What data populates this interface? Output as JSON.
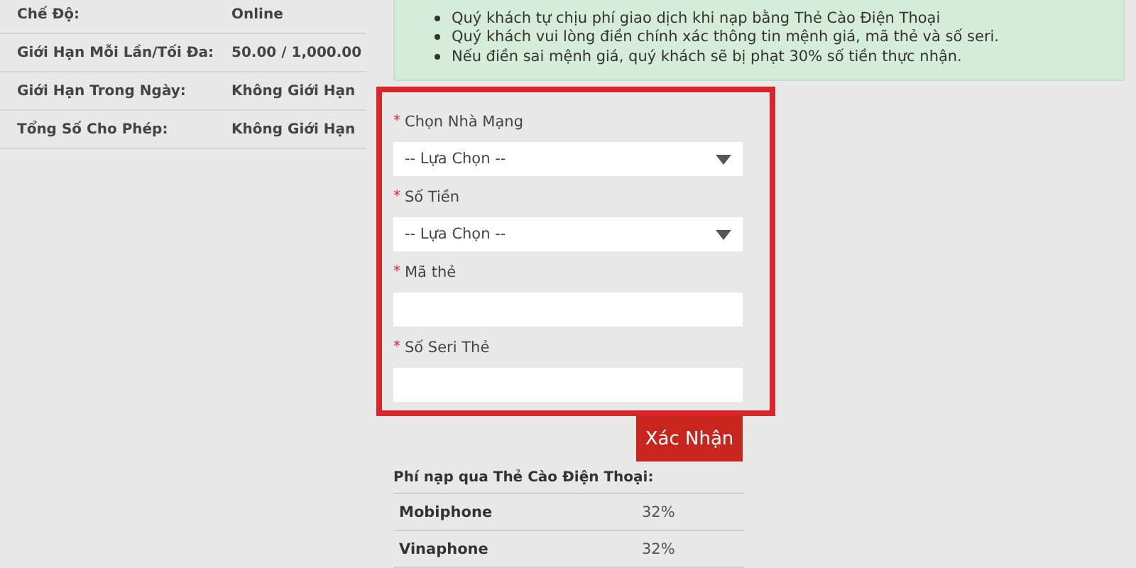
{
  "info_rows": [
    {
      "label": "Chế Độ:",
      "value": "Online"
    },
    {
      "label": "Giới Hạn Mỗi Lần/Tối Đa:",
      "value": "50.00 / 1,000.00"
    },
    {
      "label": "Giới Hạn Trong Ngày:",
      "value": "Không Giới Hạn"
    },
    {
      "label": "Tổng Số Cho Phép:",
      "value": "Không Giới Hạn"
    }
  ],
  "notices": [
    "Quý khách tự chịu phí giao dịch khi nạp bằng Thẻ Cào Điện Thoại",
    "Quý khách vui lòng điền chính xác thông tin mệnh giá, mã thẻ và số seri.",
    "Nếu điền sai mệnh giá, quý khách sẽ bị phạt 30% số tiền thực nhận."
  ],
  "form_fields": [
    {
      "kind": "select",
      "required_mark": "*",
      "label": "Chọn Nhà Mạng",
      "value": "-- Lựa Chọn --"
    },
    {
      "kind": "select",
      "required_mark": "*",
      "label": "Số Tiền",
      "value": "-- Lựa Chọn --"
    },
    {
      "kind": "text",
      "required_mark": "*",
      "label": "Mã thẻ"
    },
    {
      "kind": "text",
      "required_mark": "*",
      "label": "Số Seri Thẻ"
    }
  ],
  "submit_button": "Xác Nhận",
  "fee_table": {
    "title": "Phí nạp qua Thẻ Cào Điện Thoại:",
    "rows": [
      {
        "carrier": "Mobiphone",
        "fee": "32%"
      },
      {
        "carrier": "Vinaphone",
        "fee": "32%"
      }
    ]
  }
}
